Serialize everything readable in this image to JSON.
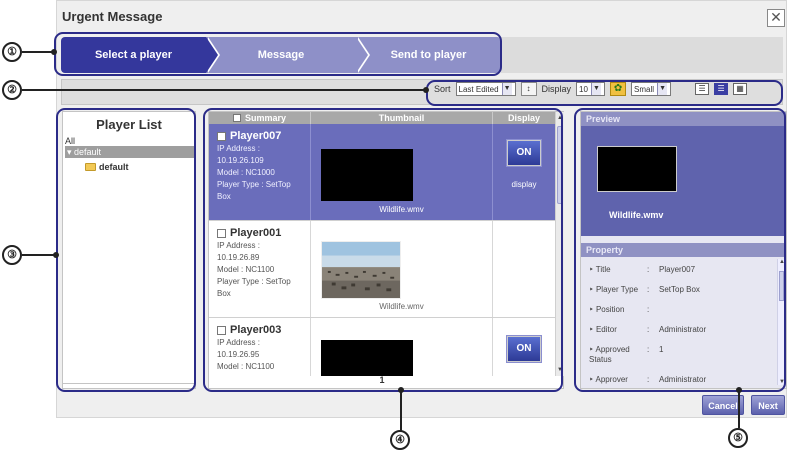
{
  "dialog": {
    "title": "Urgent Message",
    "close": "✕"
  },
  "steps": [
    {
      "label": "Select a player"
    },
    {
      "label": "Message"
    },
    {
      "label": "Send to player"
    }
  ],
  "toolbar": {
    "sort_label": "Sort",
    "sort_value": "Last Edited",
    "display_label": "Display",
    "display_count": "10",
    "size_value": "Small",
    "dropdown_glyph": "▼"
  },
  "player_list": {
    "title": "Player List",
    "all_label": "All",
    "group_label": "▾ default",
    "leaf_label": "default"
  },
  "grid": {
    "columns": [
      "Summary",
      "Thumbnail",
      "Display"
    ],
    "players": [
      {
        "name": "Player007",
        "info": [
          "IP Address :",
          "10.19.26.109",
          "Model : NC1000",
          "Player Type : SetTop",
          "Box"
        ],
        "thumb_label": "Wildlife.wmv",
        "on": "ON",
        "display": "display"
      },
      {
        "name": "Player001",
        "info": [
          "IP Address :",
          "10.19.26.89",
          "Model : NC1100",
          "Player Type : SetTop",
          "Box"
        ],
        "thumb_label": "Wildlife.wmv",
        "on": "",
        "display": ""
      },
      {
        "name": "Player003",
        "info": [
          "IP Address :",
          "10.19.26.95",
          "Model : NC1100"
        ],
        "thumb_label": "",
        "on": "ON",
        "display": ""
      }
    ],
    "page": "1"
  },
  "preview": {
    "title": "Preview",
    "file": "Wildlife.wmv"
  },
  "property": {
    "title": "Property",
    "rows": [
      {
        "k": "Title",
        "v": "Player007"
      },
      {
        "k": "Player Type",
        "v": "SetTop Box"
      },
      {
        "k": "Position",
        "v": ""
      },
      {
        "k": "Editor",
        "v": "Administrator"
      },
      {
        "k": "Approved Status",
        "v": "1"
      },
      {
        "k": "Approver",
        "v": "Administrator"
      }
    ]
  },
  "buttons": {
    "cancel": "Cancel",
    "next": "Next"
  },
  "callouts": [
    "①",
    "②",
    "③",
    "④",
    "⑤"
  ],
  "colors": {
    "accent": "#34379c",
    "step_inactive": "#8e90c8",
    "selected_row": "#6a6dbb"
  }
}
